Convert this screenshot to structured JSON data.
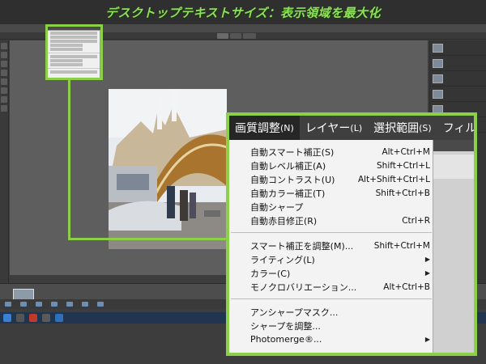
{
  "banner": {
    "title": "デスクトップテキストサイズ：表示領域を最大化"
  },
  "callout": {
    "menubar": [
      {
        "label": "画質調整",
        "accel": "(N)",
        "active": true
      },
      {
        "label": "レイヤー",
        "accel": "(L)",
        "active": false
      },
      {
        "label": "選択範囲",
        "accel": "(S)",
        "active": false
      },
      {
        "label": "フィル",
        "accel": "",
        "active": false
      }
    ],
    "groups": [
      [
        {
          "label": "自動スマート補正(S)",
          "shortcut": "Alt+Ctrl+M",
          "submenu": false
        },
        {
          "label": "自動レベル補正(A)",
          "shortcut": "Shift+Ctrl+L",
          "submenu": false
        },
        {
          "label": "自動コントラスト(U)",
          "shortcut": "Alt+Shift+Ctrl+L",
          "submenu": false
        },
        {
          "label": "自動カラー補正(T)",
          "shortcut": "Shift+Ctrl+B",
          "submenu": false
        },
        {
          "label": "自動シャープ",
          "shortcut": "",
          "submenu": false
        },
        {
          "label": "自動赤目修正(R)",
          "shortcut": "Ctrl+R",
          "submenu": false
        }
      ],
      [
        {
          "label": "スマート補正を調整(M)...",
          "shortcut": "Shift+Ctrl+M",
          "submenu": false
        },
        {
          "label": "ライティング(L)",
          "shortcut": "",
          "submenu": true
        },
        {
          "label": "カラー(C)",
          "shortcut": "",
          "submenu": true
        },
        {
          "label": "モノクロバリエーション...",
          "shortcut": "Alt+Ctrl+B",
          "submenu": false
        }
      ],
      [
        {
          "label": "アンシャープマスク...",
          "shortcut": "",
          "submenu": false
        },
        {
          "label": "シャープを調整...",
          "shortcut": "",
          "submenu": false
        },
        {
          "label": "Photomerge®...",
          "shortcut": "",
          "submenu": true
        }
      ]
    ]
  },
  "icons": {
    "submenu_arrow": "▶"
  }
}
